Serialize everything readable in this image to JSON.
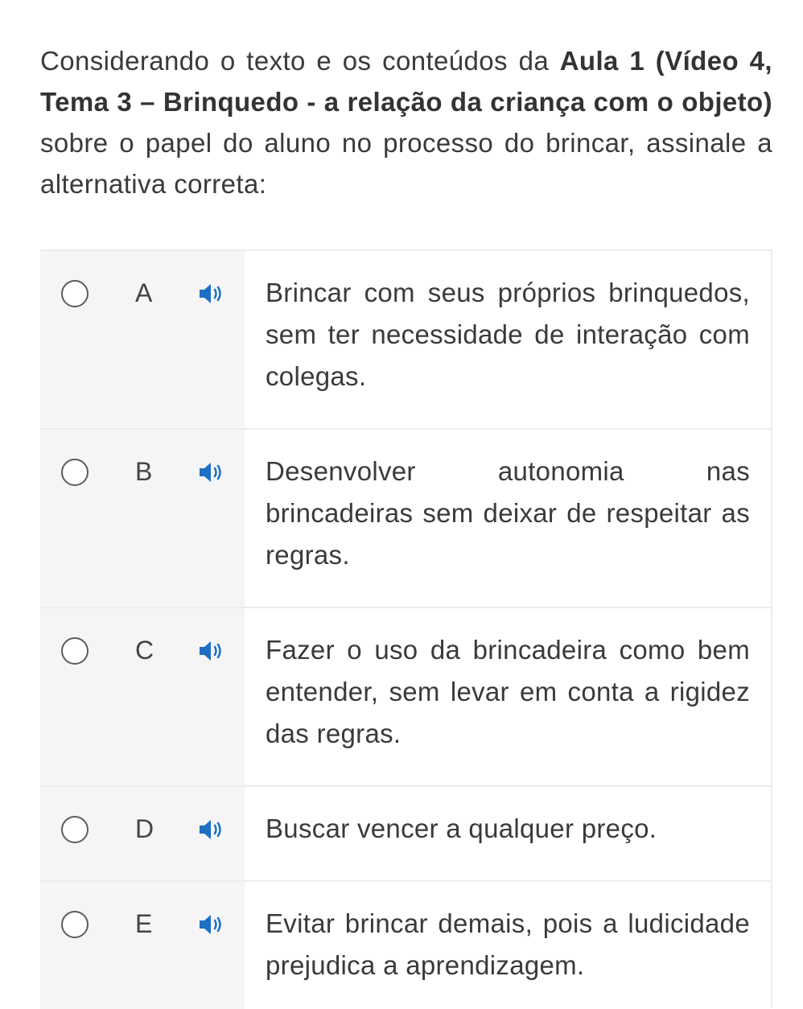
{
  "question": {
    "part1": "Considerando o texto e os conteúdos da ",
    "bold": "Aula 1 (Vídeo 4, Tema 3 – Brinquedo - a relação da criança com o objeto)",
    "part2": " sobre o papel do aluno no processo do brincar, assinale a alternativa correta:"
  },
  "options": [
    {
      "letter": "A",
      "text": "Brincar com seus próprios brinquedos, sem ter necessidade de interação com colegas."
    },
    {
      "letter": "B",
      "text": "Desenvolver autonomia nas brincadeiras sem deixar de respeitar as regras."
    },
    {
      "letter": "C",
      "text": "Fazer o uso da brincadeira como bem entender, sem levar em conta a rigidez das regras."
    },
    {
      "letter": "D",
      "text": "Buscar vencer a qualquer preço."
    },
    {
      "letter": "E",
      "text": "Evitar brincar demais, pois a ludicidade prejudica a aprendizagem."
    }
  ],
  "icons": {
    "speaker": "speaker-volume-icon",
    "radio": "radio-empty-icon"
  },
  "colors": {
    "accent": "#1d6fc4",
    "panel": "#f5f5f5",
    "border": "#ececec"
  }
}
